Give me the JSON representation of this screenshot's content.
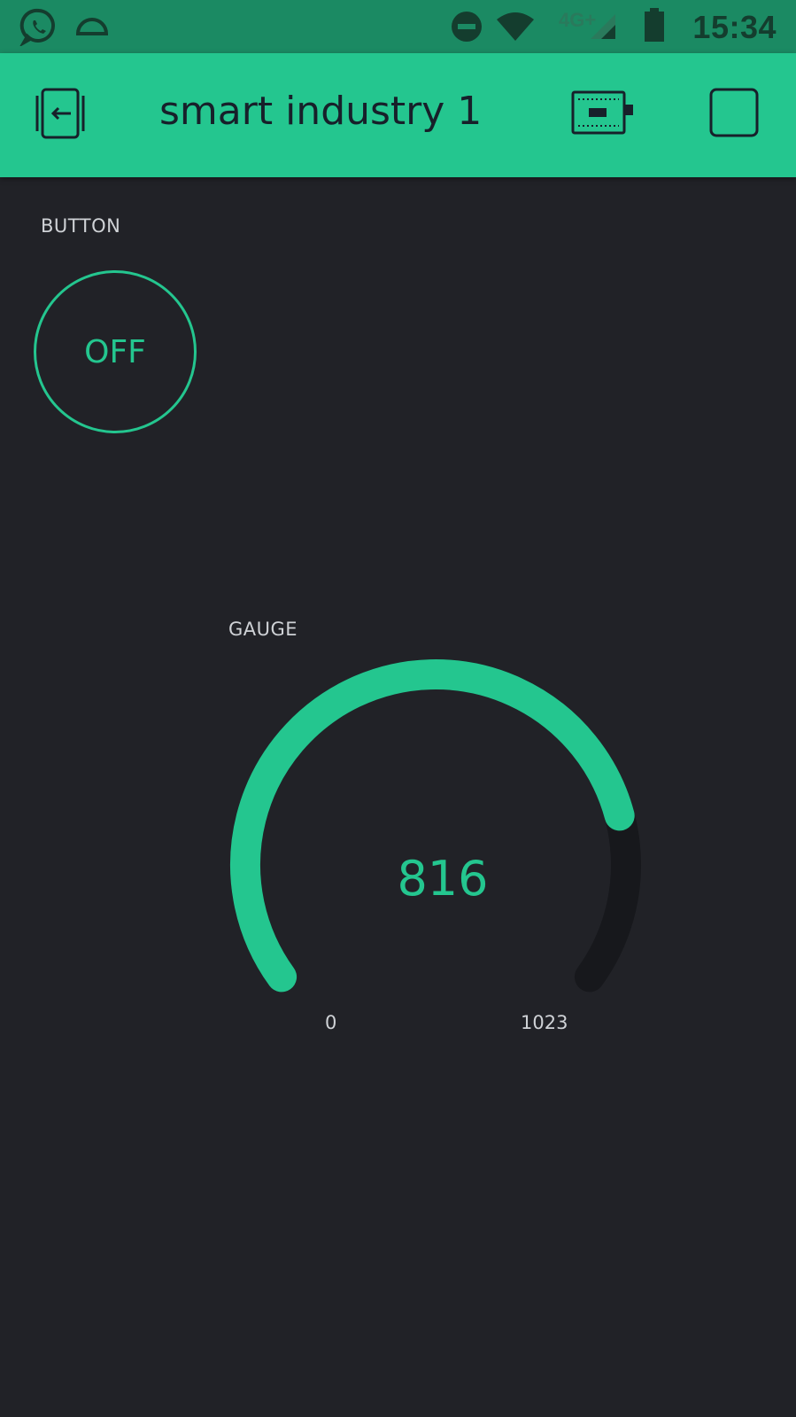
{
  "status_bar": {
    "time": "15:34",
    "network": "4G+",
    "icons": [
      "whatsapp-icon",
      "semicircle-notification-icon",
      "do-not-disturb-icon",
      "wifi-icon",
      "signal-icon",
      "battery-icon"
    ]
  },
  "app_bar": {
    "title": "smart industry 1",
    "icons": [
      "switch-project-icon",
      "device-board-icon",
      "play-stop-icon"
    ]
  },
  "widgets": {
    "button": {
      "label": "BUTTON",
      "state": "OFF"
    },
    "gauge": {
      "label": "GAUGE",
      "value": "816",
      "min": "0",
      "max": "1023",
      "value_num": 816,
      "min_num": 0,
      "max_num": 1023
    }
  },
  "colors": {
    "accent": "#24c68f",
    "status_bar": "#1b8a63",
    "background": "#212227",
    "gauge_track": "#17181c",
    "text_muted": "#cfd2d6"
  }
}
